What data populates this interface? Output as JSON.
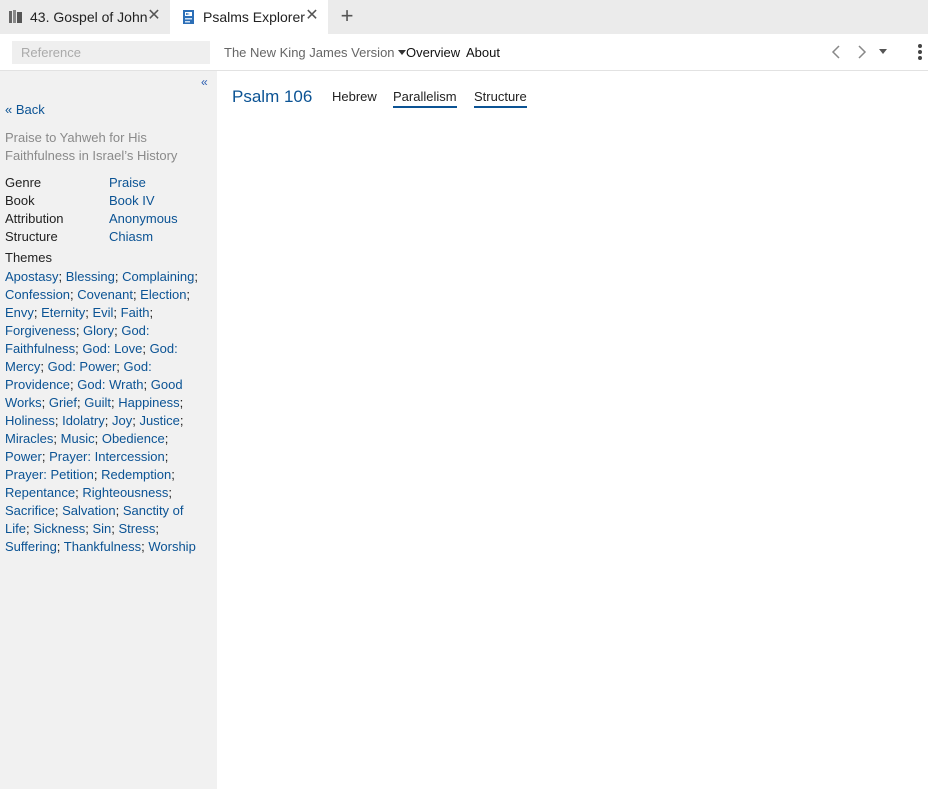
{
  "tabs": [
    {
      "label": "43. Gospel of John",
      "icon": "books-icon",
      "active": false
    },
    {
      "label": "Psalms Explorer",
      "icon": "explorer-icon",
      "active": true
    }
  ],
  "toolbar": {
    "reference_placeholder": "Reference",
    "version": "The New King James Version",
    "overview": "Overview",
    "about": "About"
  },
  "sidebar": {
    "collapse": "«",
    "back": "« Back",
    "subtitle": "Praise to Yahweh for His Faithfulness in Israel’s History",
    "meta": [
      {
        "key": "Genre",
        "value": "Praise"
      },
      {
        "key": "Book",
        "value": "Book IV"
      },
      {
        "key": "Attribution",
        "value": "Anonymous"
      },
      {
        "key": "Structure",
        "value": "Chiasm"
      }
    ],
    "themes_label": "Themes",
    "themes": [
      "Apostasy",
      "Blessing",
      "Complaining",
      "Confession",
      "Covenant",
      "Election",
      "Envy",
      "Eternity",
      "Evil",
      "Faith",
      "Forgiveness",
      "Glory",
      "God: Faithfulness",
      "God: Love",
      "God: Mercy",
      "God: Power",
      "God: Providence",
      "God: Wrath",
      "Good Works",
      "Grief",
      "Guilt",
      "Happiness",
      "Holiness",
      "Idolatry",
      "Joy",
      "Justice",
      "Miracles",
      "Music",
      "Obedience",
      "Power",
      "Prayer: Intercession",
      "Prayer: Petition",
      "Redemption",
      "Repentance",
      "Righteousness",
      "Sacrifice",
      "Salvation",
      "Sanctity of Life",
      "Sickness",
      "Sin",
      "Stress",
      "Suffering",
      "Thankfulness",
      "Worship"
    ]
  },
  "main": {
    "title": "Psalm 106",
    "tabs": [
      "Hebrew",
      "Parallelism",
      "Structure"
    ]
  },
  "colors": {
    "link": "#0b5394",
    "sidebar_bg": "#f1f1f1",
    "tabbar_bg": "#ebebeb"
  }
}
